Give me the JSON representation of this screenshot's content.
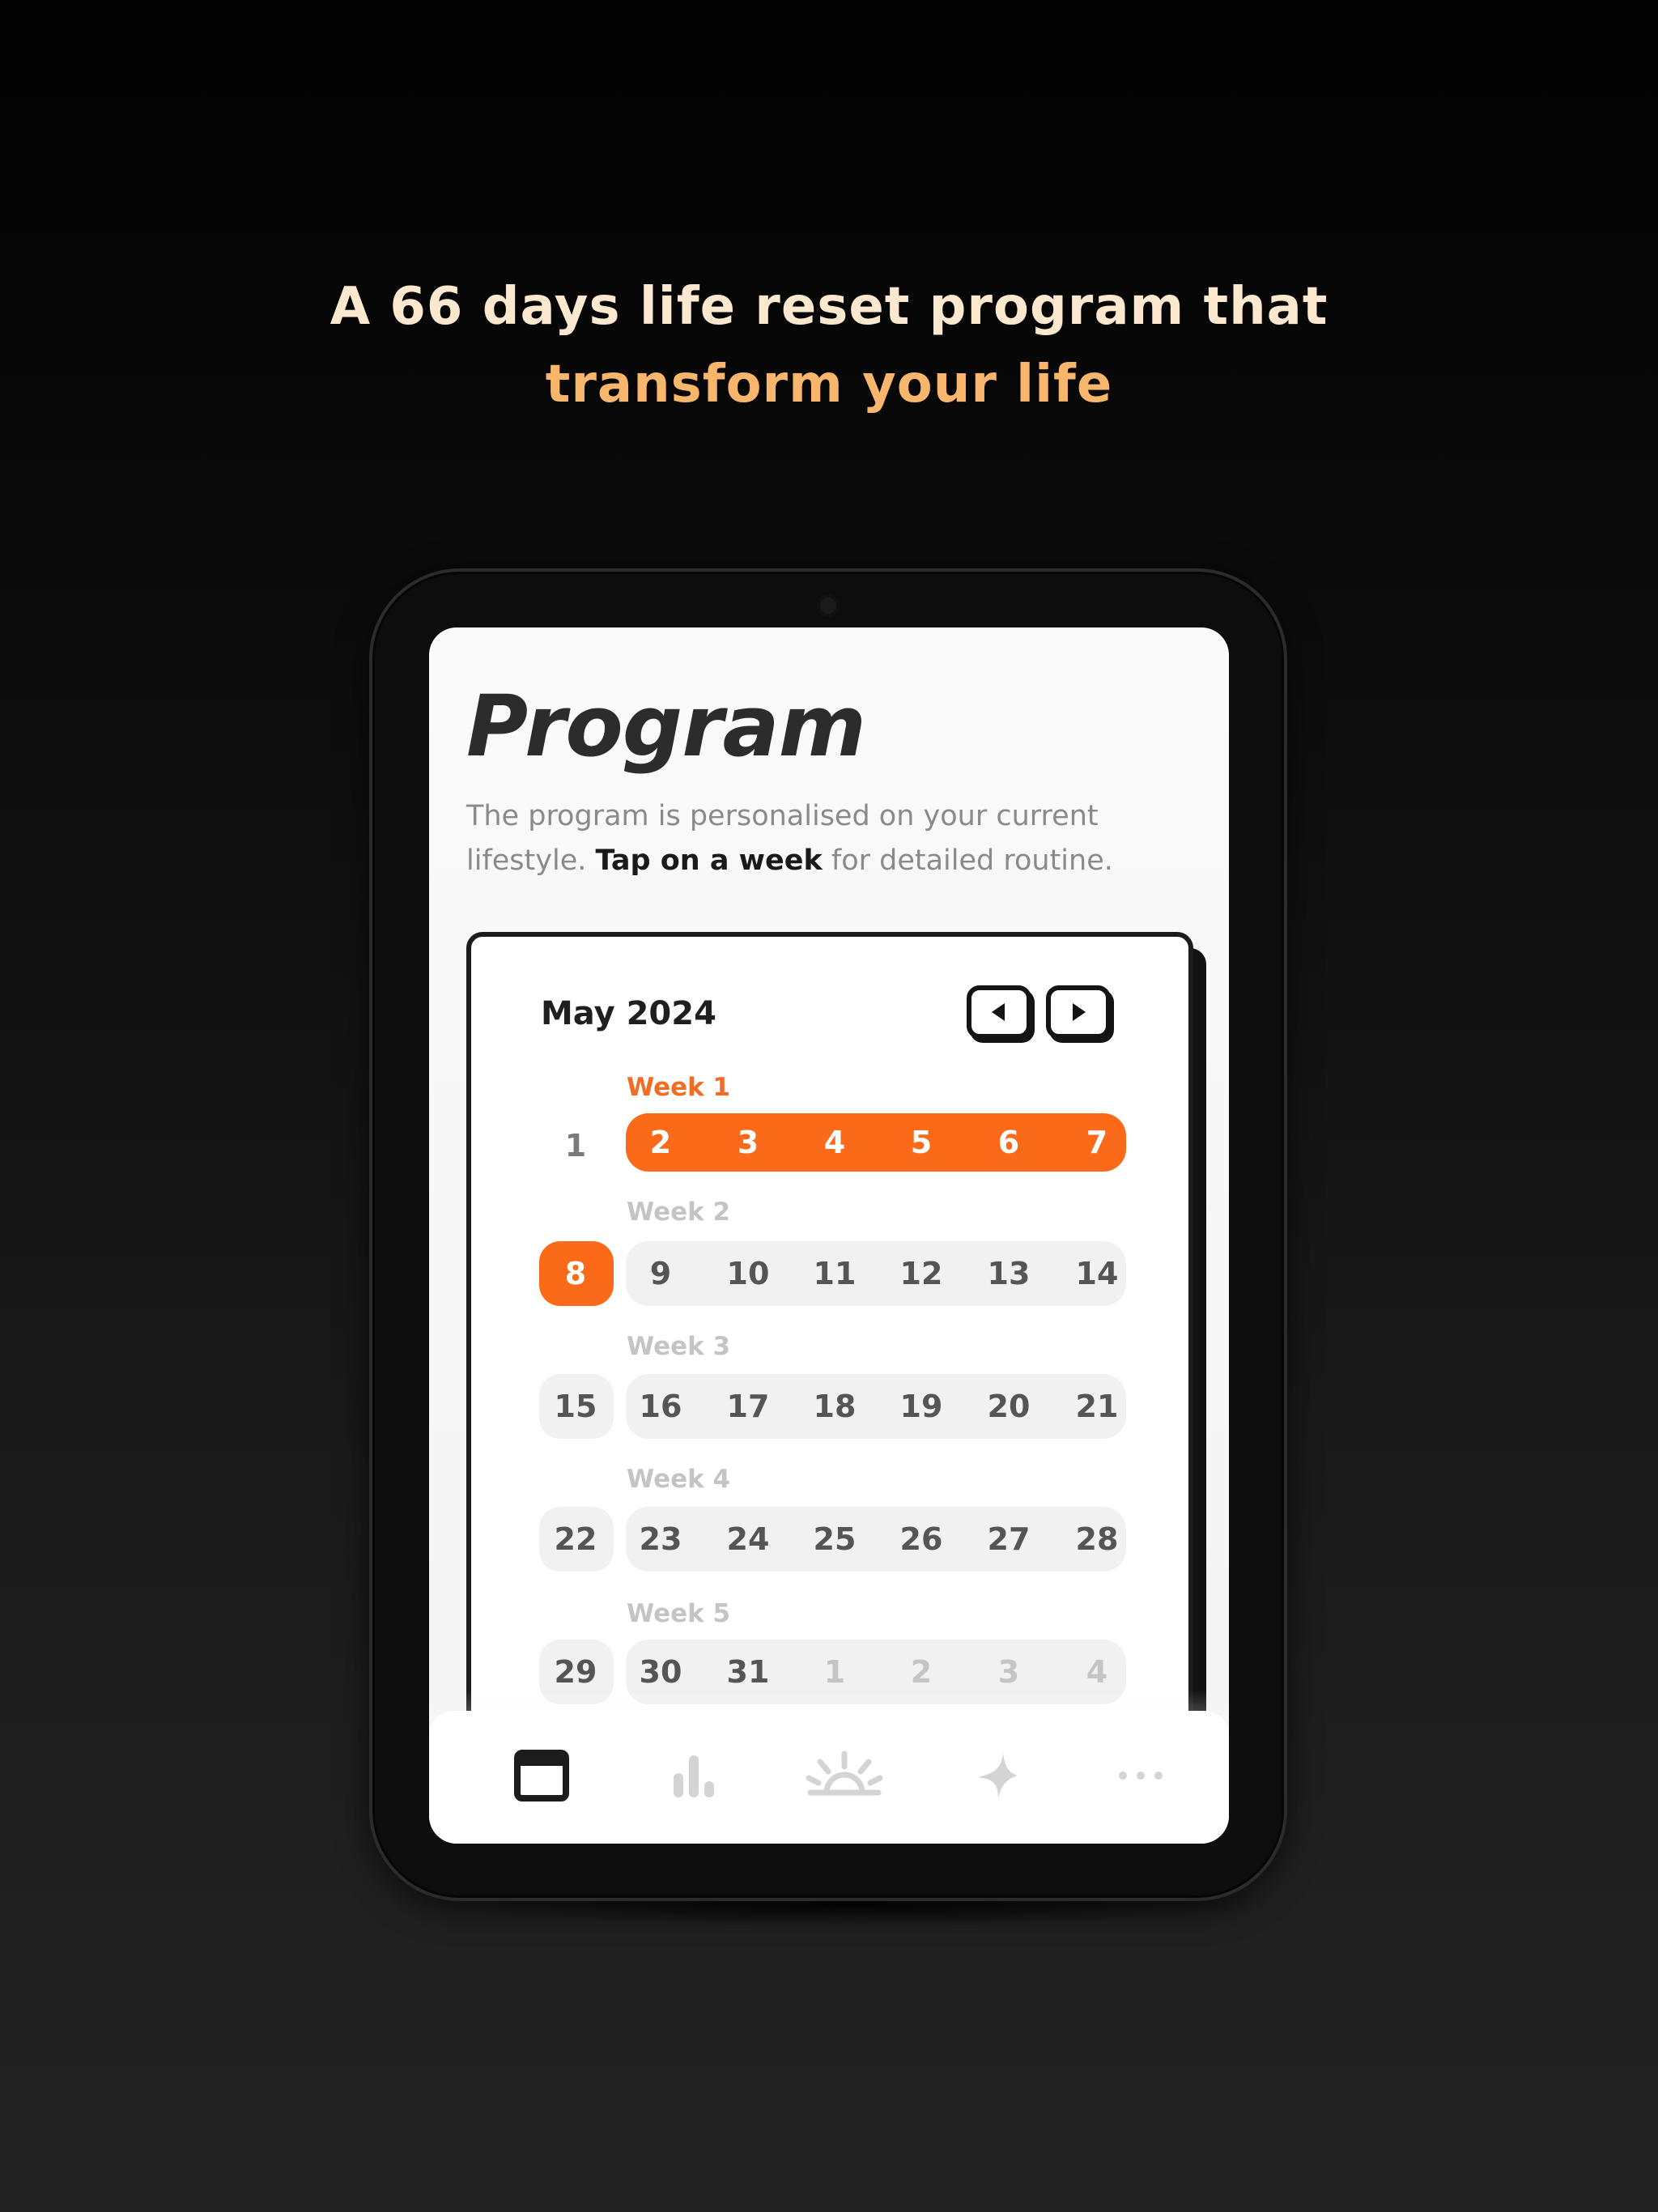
{
  "headline": {
    "line1": "A 66 days life reset program that",
    "line2": "transform your life"
  },
  "screen": {
    "title": "Program",
    "description_before": "The program is personalised on your current lifestyle. ",
    "description_bold": "Tap on a week",
    "description_after": " for detailed routine."
  },
  "calendar": {
    "month": "May 2024",
    "nav": {
      "prev_icon": "triangle-left-icon",
      "next_icon": "triangle-right-icon"
    },
    "weeks": [
      {
        "label": "Week 1",
        "lead": "1",
        "days": [
          "2",
          "3",
          "4",
          "5",
          "6",
          "7"
        ]
      },
      {
        "label": "Week 2",
        "lead": "8",
        "days": [
          "9",
          "10",
          "11",
          "12",
          "13",
          "14"
        ]
      },
      {
        "label": "Week 3",
        "lead": "15",
        "days": [
          "16",
          "17",
          "18",
          "19",
          "20",
          "21"
        ]
      },
      {
        "label": "Week 4",
        "lead": "22",
        "days": [
          "23",
          "24",
          "25",
          "26",
          "27",
          "28"
        ]
      },
      {
        "label": "Week 5",
        "lead": "29",
        "days": [
          "30",
          "31",
          "1",
          "2",
          "3",
          "4"
        ]
      }
    ]
  },
  "tabbar": {
    "items": [
      {
        "icon": "calendar-window-icon",
        "active": true
      },
      {
        "icon": "bar-chart-icon",
        "active": false
      },
      {
        "icon": "sunrise-icon",
        "active": false
      },
      {
        "icon": "sparkle-icon",
        "active": false
      },
      {
        "icon": "more-dots-icon",
        "active": false
      }
    ]
  },
  "colors": {
    "accent": "#fb6a18",
    "headline_line1": "#fce7cf",
    "headline_line2": "#f8b66c",
    "title": "#2c2c2c"
  }
}
